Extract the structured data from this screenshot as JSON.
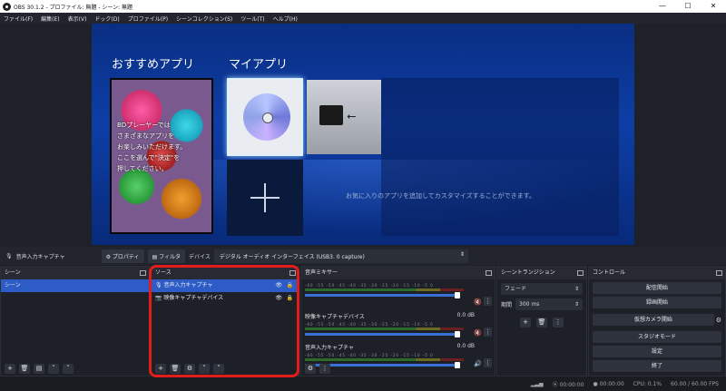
{
  "window": {
    "title": "OBS 30.1.2 - プロファイル: 無題 - シーン: 無題",
    "minimize": "—",
    "maximize": "☐",
    "close": "✕"
  },
  "menu": [
    "ファイル(F)",
    "編集(E)",
    "表示(V)",
    "ドック(D)",
    "プロファイル(P)",
    "シーンコレクション(S)",
    "ツール(T)",
    "ヘルプ(H)"
  ],
  "preview": {
    "recommended_title": "おすすめアプリ",
    "myapps_title": "マイアプリ",
    "card_text": [
      "BDプレーヤーでは",
      "さまざまなアプリを",
      "お楽しみいただけます。",
      "ここを選んで\"決定\"を",
      "押してください。"
    ],
    "myapps_message": "お気に入りのアプリを追加してカスタマイズすることができます。"
  },
  "source_bar": {
    "source_name": "音声入力キャプチャ",
    "properties": "プロパティ",
    "filters": "フィルタ",
    "device_label": "デバイス",
    "device_value": "デジタル オーディオ インターフェイス (USB3. 0 capture)"
  },
  "scenes": {
    "title": "シーン",
    "items": [
      "シーン"
    ]
  },
  "sources": {
    "title": "ソース",
    "items": [
      "音声入力キャプチャ",
      "映像キャプチャデバイス"
    ]
  },
  "mixer": {
    "title": "音声ミキサー",
    "scale": "-60 -55 -50 -45 -40 -35 -30 -25 -20 -15 -10 -5 0",
    "channels": [
      {
        "name": "",
        "db": ""
      },
      {
        "name": "映像キャプチャデバイス",
        "db": "0.0 dB"
      },
      {
        "name": "音声入力キャプチャ",
        "db": "0.0 dB"
      }
    ]
  },
  "transitions": {
    "title": "シーントランジション",
    "type": "フェード",
    "duration_label": "期間",
    "duration_value": "300 ms"
  },
  "controls": {
    "title": "コントロール",
    "buttons": [
      "配信開始",
      "録画開始",
      "仮想カメラ開始",
      "スタジオモード",
      "設定",
      "終了"
    ]
  },
  "status": {
    "stream_time": "00:00:00",
    "rec_time": "00:00:00",
    "cpu": "CPU: 0.1%",
    "fps": "60.00 / 60.00 FPS"
  }
}
